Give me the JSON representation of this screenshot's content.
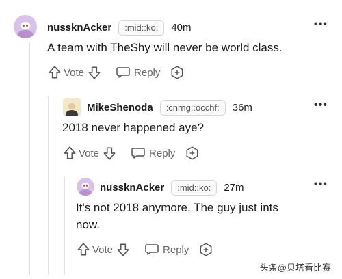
{
  "comments": [
    {
      "username": "nussknAcker",
      "flair": ":mid::ko:",
      "time": "40m",
      "text": "A team with TheShy will never be world class.",
      "vote_label": "Vote",
      "reply_label": "Reply"
    },
    {
      "username": "MikeShenoda",
      "flair": ":cnrng::occhf:",
      "time": "36m",
      "text": "2018 never happened aye?",
      "vote_label": "Vote",
      "reply_label": "Reply"
    },
    {
      "username": "nussknAcker",
      "flair": ":mid::ko:",
      "time": "27m",
      "text_line1": "It's not 2018 anymore. The guy just ints",
      "text_line2": "now.",
      "vote_label": "Vote",
      "reply_label": "Reply"
    }
  ],
  "more_label": "•••",
  "watermark": "头条@贝塔看比赛",
  "icons": [
    "upvote-icon",
    "downvote-icon",
    "reply-icon",
    "award-icon",
    "more-icon"
  ]
}
